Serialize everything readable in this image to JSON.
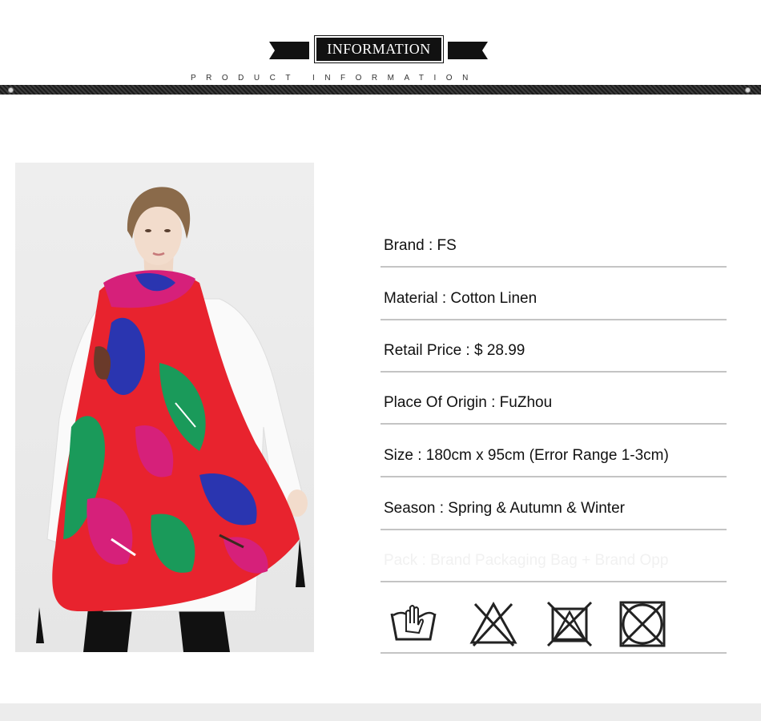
{
  "header": {
    "title": "INFORMATION",
    "subtitle": "PRODUCT INFORMATION"
  },
  "product": {
    "photo_icon": "model-wearing-scarf-photo"
  },
  "details": [
    {
      "label": "Brand : FS"
    },
    {
      "label": "Material :  Cotton Linen"
    },
    {
      "label": "Retail Price : $ 28.99"
    },
    {
      "label": "Place Of Origin : FuZhou"
    },
    {
      "label": "Size : 180cm x 95cm (Error Range 1-3cm)"
    },
    {
      "label": "Season : Spring & Autumn & Winter"
    },
    {
      "label": "Pack : Brand Packaging Bag + Brand Opp"
    }
  ],
  "care_icons": [
    "hand-wash-icon",
    "do-not-bleach-icon",
    "do-not-tumble-dry-icon",
    "do-not-dry-clean-icon"
  ],
  "colors": {
    "banner": "#111111",
    "divider": "#c4c4c4",
    "scarf_red": "#e8232e",
    "scarf_green": "#1a9a5a",
    "scarf_blue": "#2a35b0",
    "scarf_magenta": "#d6207a"
  }
}
